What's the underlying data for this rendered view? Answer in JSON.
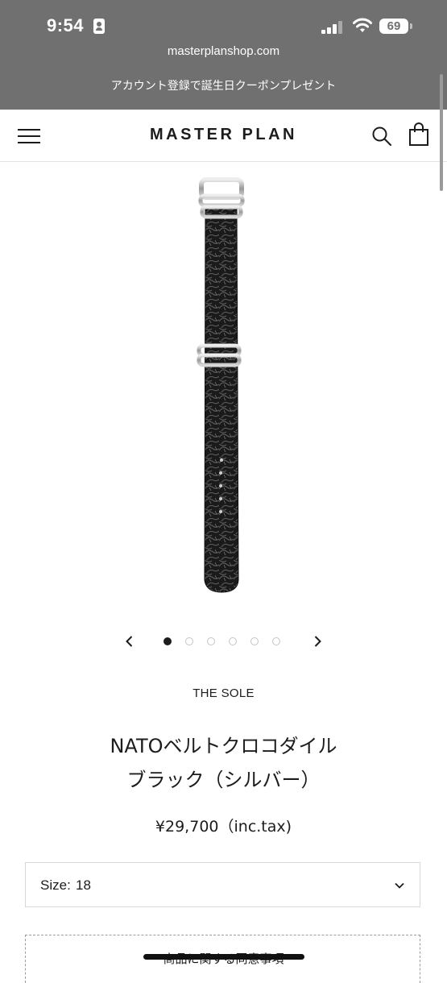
{
  "status_bar": {
    "time": "9:54",
    "battery": "69"
  },
  "browser": {
    "url": "masterplanshop.com",
    "promo_banner": "アカウント登録で誕生日クーポンプレゼント"
  },
  "header": {
    "logo": "MASTER PLAN"
  },
  "icons": {
    "menu": "hamburger-menu-icon",
    "search": "search-icon",
    "cart": "shopping-bag-icon",
    "prev": "chevron-left-icon",
    "next": "chevron-right-icon",
    "select": "chevron-down-icon"
  },
  "carousel": {
    "total_slides": 6,
    "active_index": 0
  },
  "product": {
    "brand": "THE SOLE",
    "title_line1": "NATOベルトクロコダイル",
    "title_line2": "ブラック（シルバー）",
    "price": "¥29,700（inc.tax)",
    "size_label": "Size:",
    "size_value": "18",
    "agreement_label": "商品に関する同意事項"
  },
  "colors": {
    "chrome_bg": "#707070",
    "text": "#1c1c1c",
    "border": "#d8d8d8"
  }
}
